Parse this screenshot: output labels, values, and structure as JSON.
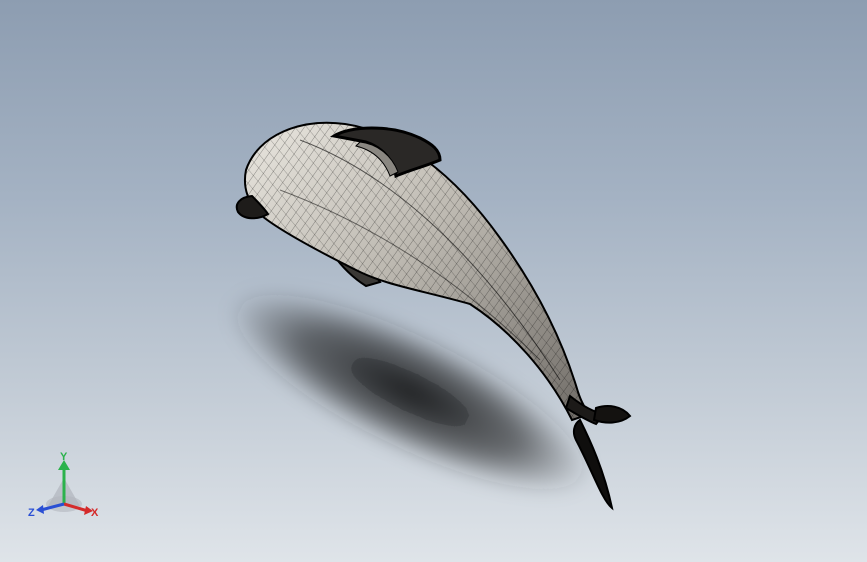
{
  "viewport": {
    "background_top": "#8d9db1",
    "background_bottom": "#dfe4e9"
  },
  "model": {
    "display_mode": "wireframe-shaded",
    "edge_color": "#000000",
    "face_color": "#c9c6bf"
  },
  "triad": {
    "x_label": "X",
    "y_label": "Y",
    "z_label": "Z",
    "x_color": "#d42a2a",
    "y_color": "#2bb24c",
    "z_color": "#2a4fd4"
  }
}
